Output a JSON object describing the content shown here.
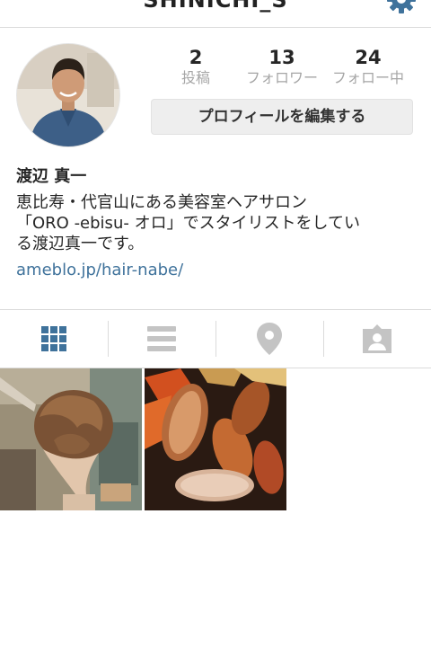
{
  "header": {
    "username": "SHINICHI_S",
    "settings_icon": "gear-icon"
  },
  "stats": [
    {
      "value": "2",
      "label": "投稿"
    },
    {
      "value": "13",
      "label": "フォロワー"
    },
    {
      "value": "24",
      "label": "フォロー中"
    }
  ],
  "edit_profile_label": "プロフィールを編集する",
  "bio": {
    "name": "渡辺 真一",
    "text": "恵比寿・代官山にある美容室ヘアサロン\n「ORO -ebisu- オロ」でスタイリストをしてい\nる渡辺真一です。",
    "link": "ameblo.jp/hair-nabe/"
  },
  "tabs": [
    "grid-icon",
    "list-icon",
    "location-pin-icon",
    "tagged-person-icon"
  ],
  "colors": {
    "accent": "#3f729b",
    "inactive": "#c4c4c4",
    "label_gray": "#a6a6a6"
  }
}
